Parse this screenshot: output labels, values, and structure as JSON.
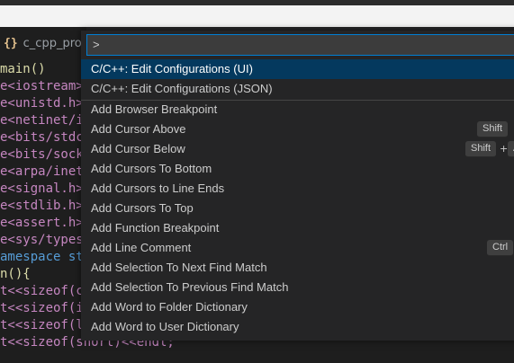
{
  "editor_tab": {
    "icon": "{}",
    "filename": "c_cpp_prop"
  },
  "code_lines": [
    [
      "fn",
      "main()"
    ],
    [
      "kw",
      "e<iostream>"
    ],
    [
      "kw",
      "e<unistd.h>"
    ],
    [
      "kw",
      "e<netinet/i"
    ],
    [
      "kw",
      "e<bits/stdc"
    ],
    [
      "kw",
      "e<bits/sock"
    ],
    [
      "kw",
      "e<arpa/inet"
    ],
    [
      "kw",
      "e<signal.h>"
    ],
    [
      "kw",
      "e<stdlib.h>"
    ],
    [
      "kw",
      "e<assert.h>"
    ],
    [
      "kw",
      "e<sys/types"
    ],
    [
      "kb",
      "amespace st"
    ],
    [
      "fn",
      "n(){"
    ],
    [
      "kw",
      "t<<sizeof(c"
    ],
    [
      "kw",
      "t<<sizeof(i"
    ],
    [
      "kw",
      "t<<sizeof(l"
    ],
    [
      "kw",
      "t<<sizeof(short)<<endl;"
    ]
  ],
  "palette": {
    "input_value": ">",
    "items": [
      "C/C++: Edit Configurations (UI)",
      "C/C++: Edit Configurations (JSON)",
      "Add Browser Breakpoint",
      "Add Cursor Above",
      "Add Cursor Below",
      "Add Cursors To Bottom",
      "Add Cursors to Line Ends",
      "Add Cursors To Top",
      "Add Function Breakpoint",
      "Add Line Comment",
      "Add Selection To Next Find Match",
      "Add Selection To Previous Find Match",
      "Add Word to Folder Dictionary",
      "Add Word to User Dictionary"
    ],
    "keybindings": {
      "cursor_above": "Shift",
      "cursor_below_1": "Shift",
      "cursor_below_plus": "+",
      "cursor_below_2": "A",
      "line_comment": "Ctrl"
    }
  }
}
